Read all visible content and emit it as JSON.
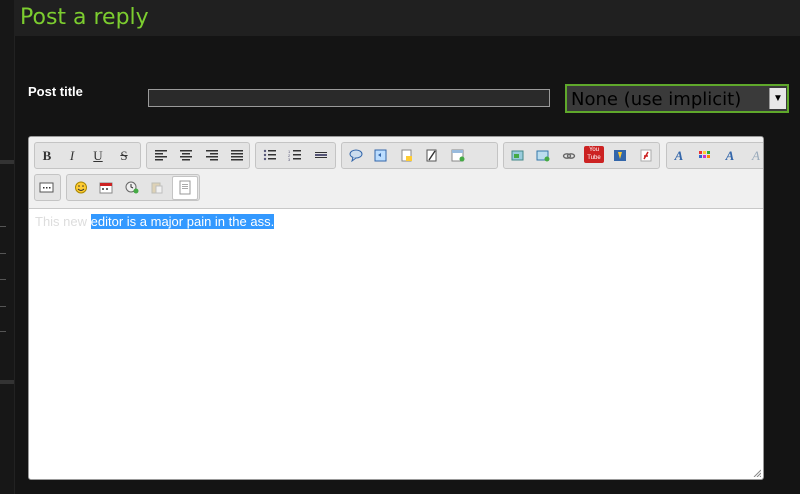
{
  "page": {
    "title": "Post a reply"
  },
  "form": {
    "post_title_label": "Post title",
    "post_title_value": "",
    "select_value": "None (use implicit)"
  },
  "toolbar": {
    "groups": [
      [
        "bold",
        "italic",
        "underline",
        "strikethrough"
      ],
      [
        "align-left",
        "align-center",
        "align-right",
        "justify"
      ],
      [
        "bullet-list",
        "numbered-list",
        "horizontal-rule"
      ],
      [
        "quote",
        "code",
        "spoiler",
        "erase",
        "table"
      ],
      [
        "image",
        "image-upload",
        "link",
        "youtube",
        "flash-swf",
        "flash"
      ],
      [
        "font",
        "color",
        "font-style",
        "remove-format"
      ],
      [
        "more"
      ],
      [
        "emoticon",
        "date",
        "insert-time",
        "paste",
        "source"
      ]
    ],
    "labels": {
      "bold": "B",
      "italic": "I",
      "underline": "U",
      "strike": "S",
      "youtube": "You Tube"
    },
    "colors": {
      "accent": "#7ccd2f",
      "selection": "#3399ff"
    }
  },
  "editor": {
    "text_faint": "This new ",
    "text_selected": "editor is a major pain in the ass."
  }
}
